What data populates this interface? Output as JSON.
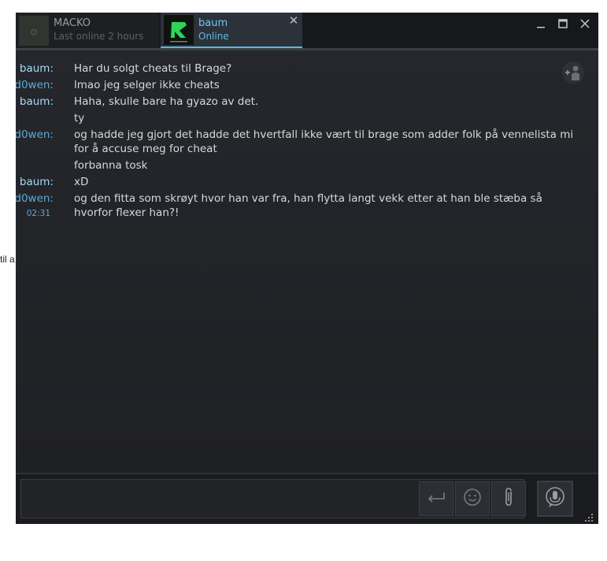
{
  "background_fragment": "til a",
  "tabs": [
    {
      "name": "MACKO",
      "status": "Last online 2 hours",
      "active": false
    },
    {
      "name": "baum",
      "status": "Online",
      "active": true
    }
  ],
  "icons": {
    "tab_close": "close-icon",
    "minimize": "minimize-icon",
    "maximize": "maximize-icon",
    "close": "close-icon",
    "add_friend": "add-friend-icon",
    "enter": "enter-icon",
    "emoji": "emoji-icon",
    "attach": "paperclip-icon",
    "voice": "voice-chat-icon"
  },
  "messages": [
    {
      "sender": "baum:",
      "text": "Har du solgt cheats til Brage?",
      "time": ""
    },
    {
      "sender": "d0wen:",
      "text": "lmao jeg selger ikke cheats",
      "time": ""
    },
    {
      "sender": "baum:",
      "text": "Haha, skulle bare ha gyazo av det.",
      "time": ""
    },
    {
      "sender": "",
      "text": "ty",
      "time": ""
    },
    {
      "sender": "d0wen:",
      "text": "og hadde jeg gjort det hadde det hvertfall ikke vært til brage som adder folk på vennelista mi for å accuse meg for cheat",
      "time": ""
    },
    {
      "sender": "",
      "text": "forbanna tosk",
      "time": ""
    },
    {
      "sender": "baum:",
      "text": "xD",
      "time": ""
    },
    {
      "sender": "d0wen:",
      "text": "og den fitta som skrøyt hvor han var fra, han flytta langt vekk etter at han ble stæba så hvorfor flexer han?!",
      "time": "02:31"
    }
  ],
  "colors": {
    "accent": "#5fb7e0",
    "baum_name": "#a7d9f7",
    "d0wen_name": "#5fa9d3",
    "window_bg": "#1f2024"
  }
}
